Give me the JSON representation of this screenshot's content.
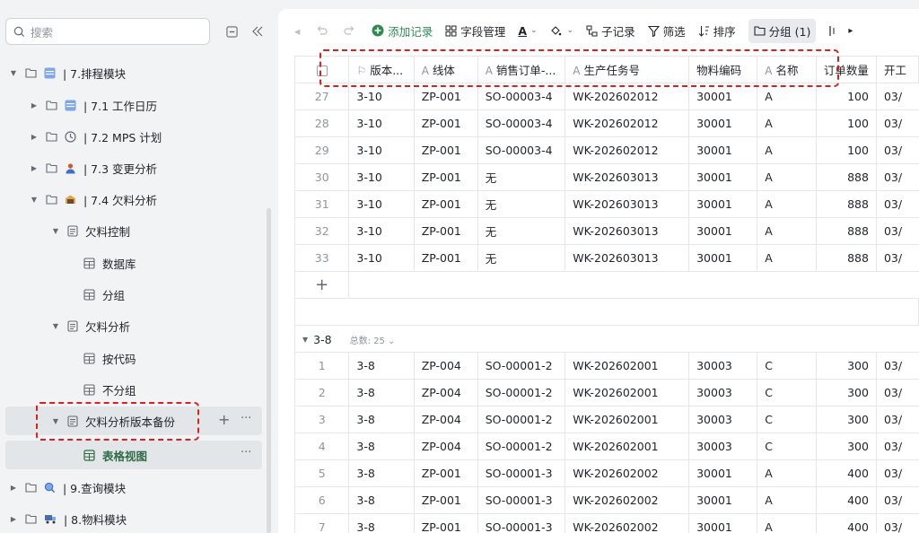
{
  "sidebar": {
    "search_placeholder": "搜索",
    "tree": [
      {
        "label": "| 7.排程模块",
        "icon": "grid-icon"
      },
      {
        "label": "| 7.1 工作日历",
        "icon": "grid-icon"
      },
      {
        "label": "| 7.2 MPS 计划",
        "icon": "clock-icon"
      },
      {
        "label": "| 7.3 变更分析",
        "icon": "person-icon"
      },
      {
        "label": "| 7.4 欠料分析",
        "icon": "box-icon"
      },
      {
        "label": "欠料控制",
        "icon": "doc-icon"
      },
      {
        "label": "数据库",
        "icon": "table-icon"
      },
      {
        "label": "分组",
        "icon": "table-icon"
      },
      {
        "label": "欠料分析",
        "icon": "doc-icon"
      },
      {
        "label": "按代码",
        "icon": "table-icon"
      },
      {
        "label": "不分组",
        "icon": "table-icon"
      },
      {
        "label": "欠料分析版本备份",
        "icon": "doc-icon"
      },
      {
        "label": "表格视图",
        "icon": "table-icon"
      },
      {
        "label": "| 9.查询模块",
        "icon": "search-icon"
      },
      {
        "label": "| 8.物料模块",
        "icon": "truck-icon"
      }
    ]
  },
  "toolbar": {
    "add_record": "添加记录",
    "field_manage": "字段管理",
    "sub_record": "子记录",
    "filter": "筛选",
    "sort": "排序",
    "group": "分组 (1)"
  },
  "table": {
    "headers": [
      "版本...",
      "线体",
      "销售订单-...",
      "生产任务号",
      "物料编码",
      "名称",
      "订单数量",
      "开工"
    ],
    "group_a_rows": [
      [
        "27",
        "3-10",
        "ZP-001",
        "SO-00003-4",
        "WK-202602012",
        "30001",
        "A",
        "100",
        "03/"
      ],
      [
        "28",
        "3-10",
        "ZP-001",
        "SO-00003-4",
        "WK-202602012",
        "30001",
        "A",
        "100",
        "03/"
      ],
      [
        "29",
        "3-10",
        "ZP-001",
        "SO-00003-4",
        "WK-202602012",
        "30001",
        "A",
        "100",
        "03/"
      ],
      [
        "30",
        "3-10",
        "ZP-001",
        "无",
        "WK-202603013",
        "30001",
        "A",
        "888",
        "03/"
      ],
      [
        "31",
        "3-10",
        "ZP-001",
        "无",
        "WK-202603013",
        "30001",
        "A",
        "888",
        "03/"
      ],
      [
        "32",
        "3-10",
        "ZP-001",
        "无",
        "WK-202603013",
        "30001",
        "A",
        "888",
        "03/"
      ],
      [
        "33",
        "3-10",
        "ZP-001",
        "无",
        "WK-202603013",
        "30001",
        "A",
        "888",
        "03/"
      ]
    ],
    "group_b": {
      "label": "3-8",
      "count_label": "总数: 25"
    },
    "group_b_rows": [
      [
        "1",
        "3-8",
        "ZP-004",
        "SO-00001-2",
        "WK-202602001",
        "30003",
        "C",
        "300",
        "03/"
      ],
      [
        "2",
        "3-8",
        "ZP-004",
        "SO-00001-2",
        "WK-202602001",
        "30003",
        "C",
        "300",
        "03/"
      ],
      [
        "3",
        "3-8",
        "ZP-004",
        "SO-00001-2",
        "WK-202602001",
        "30003",
        "C",
        "300",
        "03/"
      ],
      [
        "4",
        "3-8",
        "ZP-004",
        "SO-00001-2",
        "WK-202602001",
        "30003",
        "C",
        "300",
        "03/"
      ],
      [
        "5",
        "3-8",
        "ZP-001",
        "SO-00001-3",
        "WK-202602002",
        "30001",
        "A",
        "400",
        "03/"
      ],
      [
        "6",
        "3-8",
        "ZP-001",
        "SO-00001-3",
        "WK-202602002",
        "30001",
        "A",
        "400",
        "03/"
      ],
      [
        "7",
        "3-8",
        "ZP-001",
        "SO-00001-3",
        "WK-202602002",
        "30001",
        "A",
        "400",
        "03/"
      ]
    ]
  },
  "colors": {
    "accent_green": "#2f8a52",
    "highlight_red": "#d92121"
  }
}
